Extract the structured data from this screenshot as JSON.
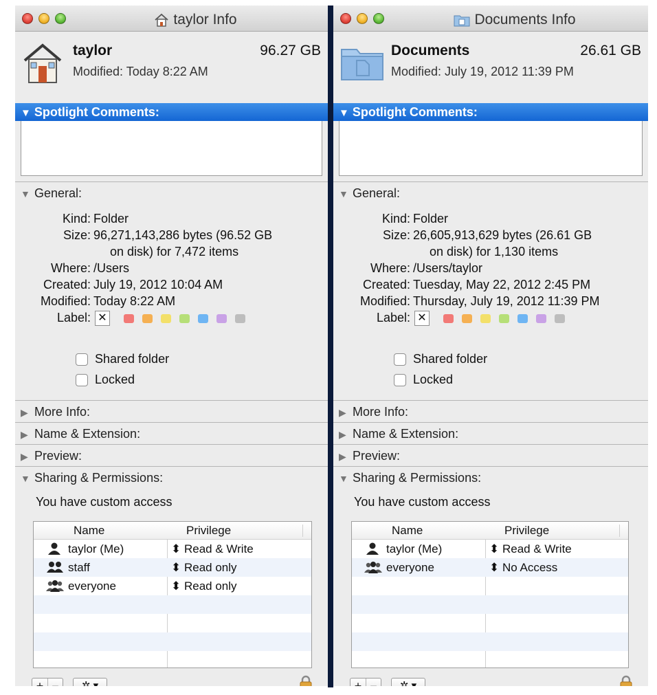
{
  "windows": [
    {
      "title": "taylor Info",
      "title_icon": "home-icon",
      "name": "taylor",
      "size_short": "96.27 GB",
      "modified_header": "Modified: Today 8:22 AM",
      "spotlight_label": "Spotlight Comments:",
      "general_label": "General:",
      "kind_label": "Kind:",
      "kind": "Folder",
      "size_label": "Size:",
      "size_line1": "96,271,143,286 bytes (96.52 GB",
      "size_line2": "on disk) for 7,472 items",
      "where_label": "Where:",
      "where": "/Users",
      "created_label": "Created:",
      "created": "July 19, 2012 10:04 AM",
      "modified_label": "Modified:",
      "modified": "Today 8:22 AM",
      "label_label": "Label:",
      "shared_label": "Shared folder",
      "locked_label": "Locked",
      "more_info": "More Info:",
      "name_ext": "Name & Extension:",
      "preview": "Preview:",
      "sharing": "Sharing & Permissions:",
      "access": "You have custom access",
      "col_name": "Name",
      "col_priv": "Privilege",
      "rows": [
        {
          "name": "taylor (Me)",
          "privilege": "Read & Write",
          "icon": "single-user-icon"
        },
        {
          "name": "staff",
          "privilege": "Read only",
          "icon": "group-icon"
        },
        {
          "name": "everyone",
          "privilege": "Read only",
          "icon": "everyone-icon"
        }
      ]
    },
    {
      "title": "Documents Info",
      "title_icon": "folder-icon",
      "name": "Documents",
      "size_short": "26.61 GB",
      "modified_header": "Modified: July 19, 2012 11:39 PM",
      "spotlight_label": "Spotlight Comments:",
      "general_label": "General:",
      "kind_label": "Kind:",
      "kind": "Folder",
      "size_label": "Size:",
      "size_line1": "26,605,913,629 bytes (26.61 GB",
      "size_line2": "on disk) for 1,130 items",
      "where_label": "Where:",
      "where": "/Users/taylor",
      "created_label": "Created:",
      "created": "Tuesday, May 22, 2012 2:45 PM",
      "modified_label": "Modified:",
      "modified": "Thursday, July 19, 2012 11:39 PM",
      "label_label": "Label:",
      "shared_label": "Shared folder",
      "locked_label": "Locked",
      "more_info": "More Info:",
      "name_ext": "Name & Extension:",
      "preview": "Preview:",
      "sharing": "Sharing & Permissions:",
      "access": "You have custom access",
      "col_name": "Name",
      "col_priv": "Privilege",
      "rows": [
        {
          "name": "taylor (Me)",
          "privilege": "Read & Write",
          "icon": "single-user-icon"
        },
        {
          "name": "everyone",
          "privilege": "No Access",
          "icon": "everyone-icon"
        }
      ]
    }
  ],
  "label_colors": [
    "#f27a77",
    "#f5b053",
    "#f3e06a",
    "#b6df78",
    "#6fb5f3",
    "#c9a2e6",
    "#bdbdbd"
  ],
  "controls": {
    "add": "+",
    "remove": "−",
    "gear": "✲ ▾",
    "updown": "⬍"
  }
}
